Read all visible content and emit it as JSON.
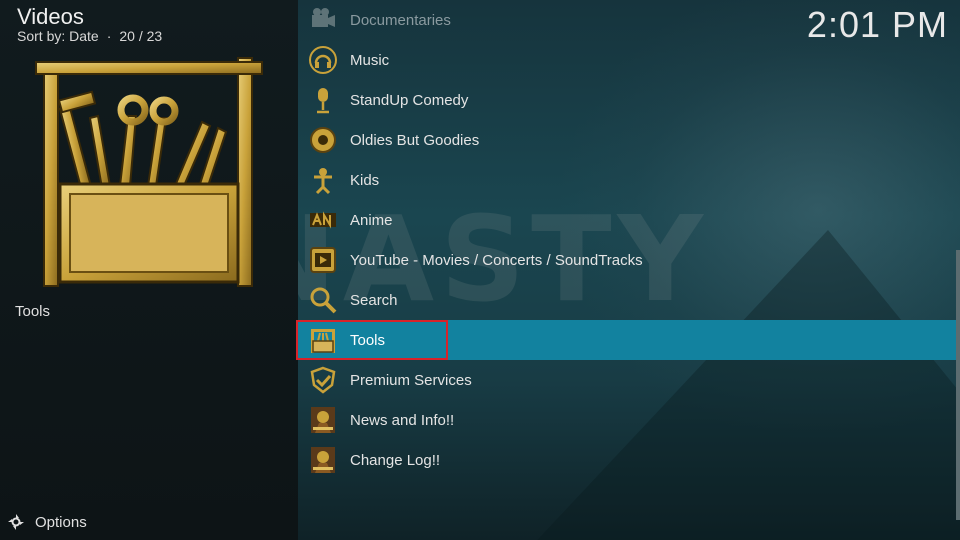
{
  "header": {
    "title": "Videos",
    "sort_label": "Sort by: Date",
    "position": "20 / 23",
    "clock": "2:01 PM"
  },
  "left_panel": {
    "selected_label": "Tools",
    "thumbnail_icon": "toolbox-icon",
    "options_label": "Options"
  },
  "menu": {
    "items": [
      {
        "label": "Documentaries",
        "icon": "film-camera-icon"
      },
      {
        "label": "Music",
        "icon": "headphones-icon"
      },
      {
        "label": "StandUp Comedy",
        "icon": "microphone-icon"
      },
      {
        "label": "Oldies But Goodies",
        "icon": "oldies-badge-icon"
      },
      {
        "label": "Kids",
        "icon": "kids-icon"
      },
      {
        "label": "Anime",
        "icon": "anime-icon"
      },
      {
        "label": "YouTube - Movies / Concerts / SoundTracks",
        "icon": "youtube-icon"
      },
      {
        "label": "Search",
        "icon": "magnifier-icon"
      },
      {
        "label": "Tools",
        "icon": "toolbox-icon"
      },
      {
        "label": "Premium Services",
        "icon": "shield-check-icon"
      },
      {
        "label": "News and Info!!",
        "icon": "dynasty-icon"
      },
      {
        "label": "Change Log!!",
        "icon": "dynasty-icon"
      }
    ],
    "focused_index": 8
  },
  "background": {
    "watermark_text": "NASTY"
  },
  "colors": {
    "focus_bar": "#12829f",
    "highlight_box": "#d8232a",
    "gold": "#c9a23a"
  }
}
